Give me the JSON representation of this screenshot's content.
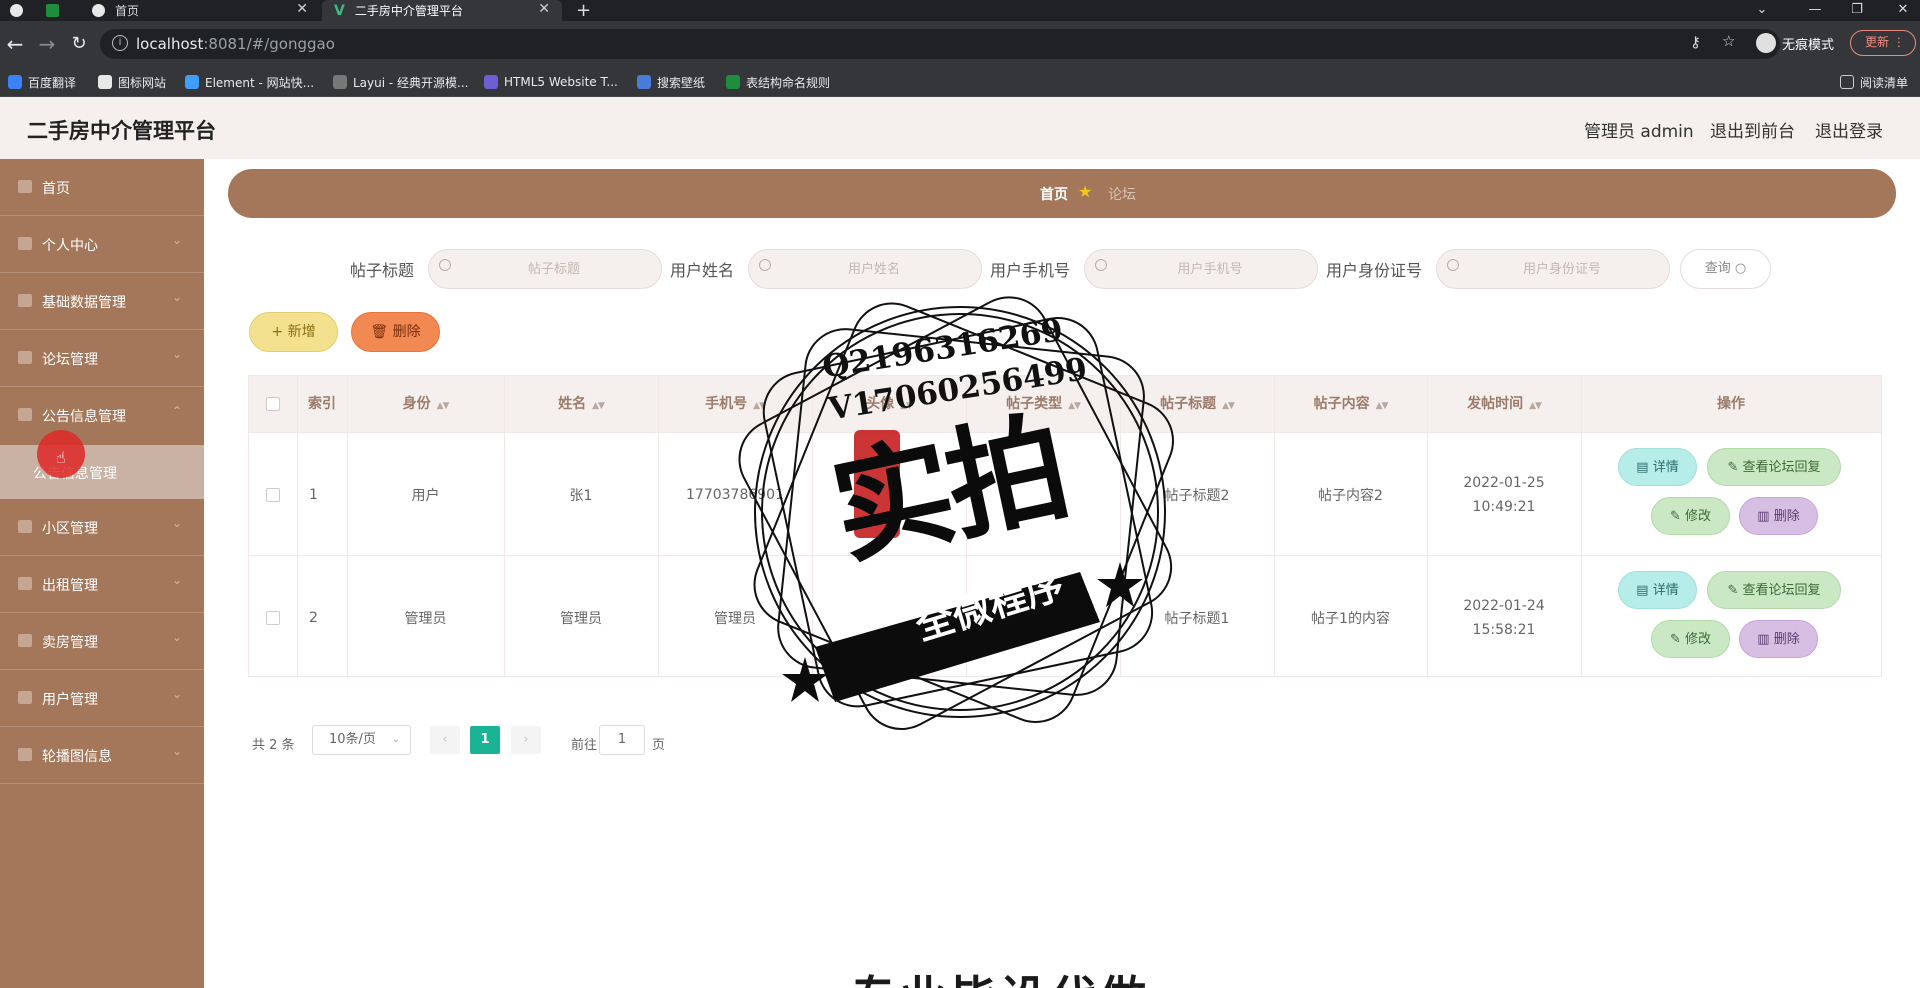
{
  "browser": {
    "tabs": [
      {
        "label": ""
      },
      {
        "label": "首页"
      },
      {
        "label": "二手房中介管理平台"
      }
    ],
    "url_host": "localhost",
    "url_rest": ":8081/#/gonggao",
    "incognito_label": "无痕模式",
    "update_label": "更新",
    "bookmarks": [
      "百度翻译",
      "图标网站",
      "Element - 网站快...",
      "Layui - 经典开源模...",
      "HTML5 Website T...",
      "搜索壁纸",
      "表结构命名规则"
    ],
    "reading_list": "阅读清单",
    "colors": {
      "tabbar": "#202124",
      "toolbar": "#35363a"
    }
  },
  "header": {
    "title": "二手房中介管理平台",
    "user_label": "管理员 admin",
    "front_link": "退出到前台",
    "logout_link": "退出登录"
  },
  "sidebar": {
    "items": [
      {
        "label": "首页",
        "icon": "home-icon"
      },
      {
        "label": "个人中心",
        "icon": "user-icon"
      },
      {
        "label": "基础数据管理",
        "icon": "data-icon"
      },
      {
        "label": "论坛管理",
        "icon": "forum-icon"
      },
      {
        "label": "公告信息管理",
        "icon": "notice-icon"
      },
      {
        "label": "小区管理",
        "icon": "community-icon"
      },
      {
        "label": "出租管理",
        "icon": "rent-icon"
      },
      {
        "label": "卖房管理",
        "icon": "sale-icon"
      },
      {
        "label": "用户管理",
        "icon": "users-icon"
      },
      {
        "label": "轮播图信息",
        "icon": "carousel-icon"
      }
    ],
    "subitem": "公告信息管理",
    "colors": {
      "bg": "#a5775a",
      "active_sub": "#c9b1a3"
    }
  },
  "breadcrumb": {
    "home": "首页",
    "current": "论坛"
  },
  "search": {
    "fields": [
      {
        "label": "帖子标题",
        "placeholder": "帖子标题"
      },
      {
        "label": "用户姓名",
        "placeholder": "用户姓名"
      },
      {
        "label": "用户手机号",
        "placeholder": "用户手机号"
      },
      {
        "label": "用户身份证号",
        "placeholder": "用户身份证号"
      }
    ],
    "query_label": "查询"
  },
  "actions": {
    "add_label": "新增",
    "delete_label": "删除"
  },
  "table": {
    "columns": [
      "索引",
      "身份",
      "姓名",
      "手机号",
      "头像",
      "帖子类型",
      "帖子标题",
      "帖子内容",
      "发帖时间",
      "操作"
    ],
    "rows": [
      {
        "index": "1",
        "role": "用户",
        "name": "张1",
        "phone": "17703786901",
        "title": "帖子标题2",
        "content": "帖子内容2",
        "time": "2022-01-25 10:49:21"
      },
      {
        "index": "2",
        "role": "管理员",
        "name": "管理员",
        "phone": "管理员",
        "title": "帖子标题1",
        "content": "帖子1的内容",
        "time": "2022-01-24 15:58:21"
      }
    ],
    "ops": {
      "detail": "详情",
      "reply": "查看论坛回复",
      "edit": "修改",
      "delete": "删除"
    }
  },
  "pagination": {
    "total_text": "共 2 条",
    "page_size": "10条/页",
    "current_page": "1",
    "goto_prefix": "前往",
    "goto_value": "1",
    "goto_suffix": "页"
  },
  "watermark": {
    "qq": "Q2196316269",
    "vx": "V17060256499",
    "big": "实拍",
    "ribbon": "全微程序"
  },
  "bottom_caption": "专业毕设代做"
}
